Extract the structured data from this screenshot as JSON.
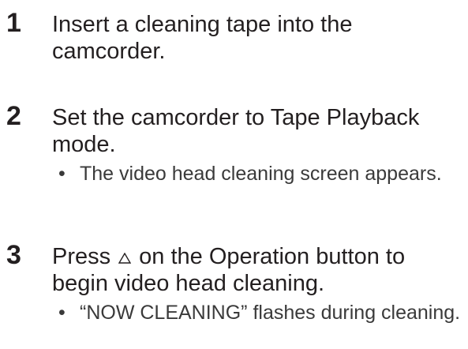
{
  "steps": [
    {
      "number": "1",
      "text": "Insert a cleaning tape into the camcorder."
    },
    {
      "number": "2",
      "text": "Set the camcorder to Tape Playback mode.",
      "bullet": "The video head cleaning screen appears."
    },
    {
      "number": "3",
      "text_before_icon": "Press",
      "icon": "up-triangle-icon",
      "text_after_icon": "on the Operation button to begin video head cleaning.",
      "bullet": "“NOW CLEANING” flashes during cleaning."
    }
  ],
  "bullet_symbol": "•"
}
